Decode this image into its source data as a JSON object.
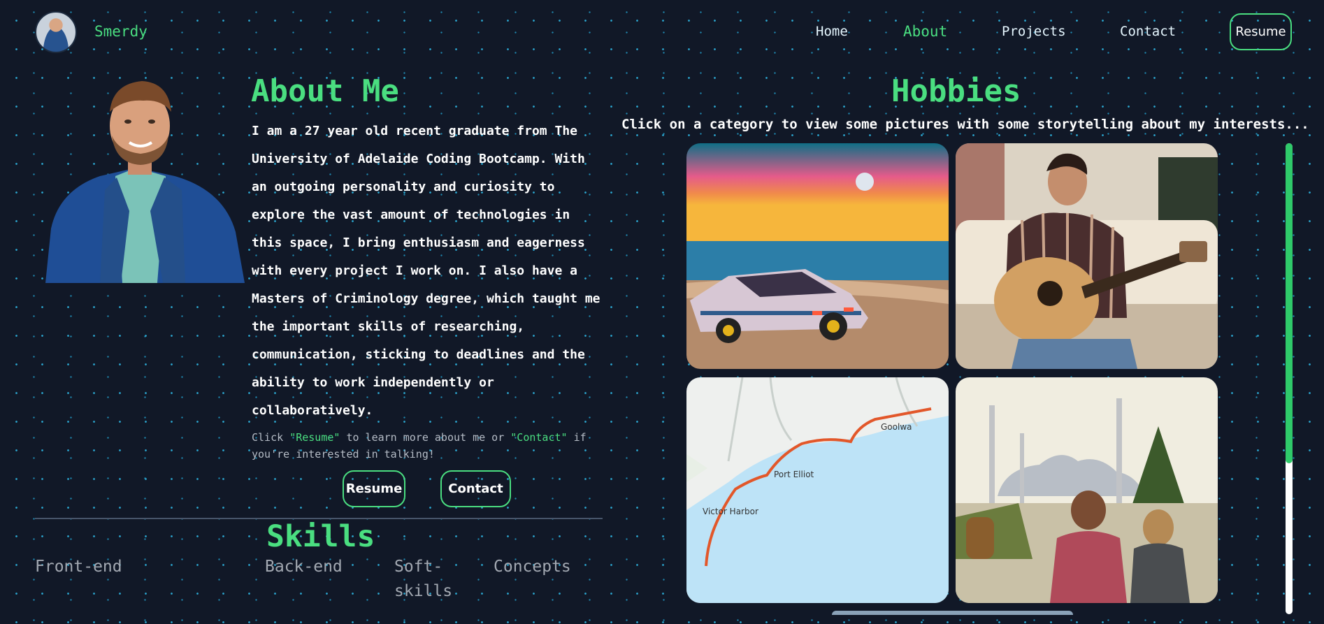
{
  "nav": {
    "brand": "Smerdy",
    "links": [
      "Home",
      "About",
      "Projects",
      "Contact"
    ],
    "active": "About",
    "resume_label": "Resume"
  },
  "about": {
    "title": "About Me",
    "paragraph": "I am a 27 year old recent graduate from The University of Adelaide Coding Bootcamp. With an outgoing personality and curiosity to explore the vast amount of technologies in this space, I bring enthusiasm and eagerness with every project I work on. I also have a Masters of Criminology degree, which taught me the important skills of researching, communication, sticking to deadlines and the ability to work independently or collaboratively.",
    "note_prefix": "Click ",
    "note_resume": "\"Resume\"",
    "note_middle": " to learn more about me or ",
    "note_contact": "\"Contact\"",
    "note_suffix": " if you're interested in talking!",
    "resume_button": "Resume",
    "contact_button": "Contact"
  },
  "skills": {
    "title": "Skills",
    "tabs": [
      "Front-end",
      "Back-end",
      "Soft-skills",
      "Concepts"
    ]
  },
  "hobbies": {
    "title": "Hobbies",
    "subtitle": "Click on a category to view some pictures with some storytelling about my interests...",
    "tiles": [
      "car-on-beach-sunset-image",
      "playing-guitar-image",
      "cycling-route-map-image",
      "mosque-travel-image"
    ],
    "map_labels": [
      "Goolwa",
      "Port Elliot",
      "Victor Harbor"
    ]
  },
  "colors": {
    "accent": "#4ade80",
    "background": "#111827",
    "star": "#2aa3cc"
  }
}
